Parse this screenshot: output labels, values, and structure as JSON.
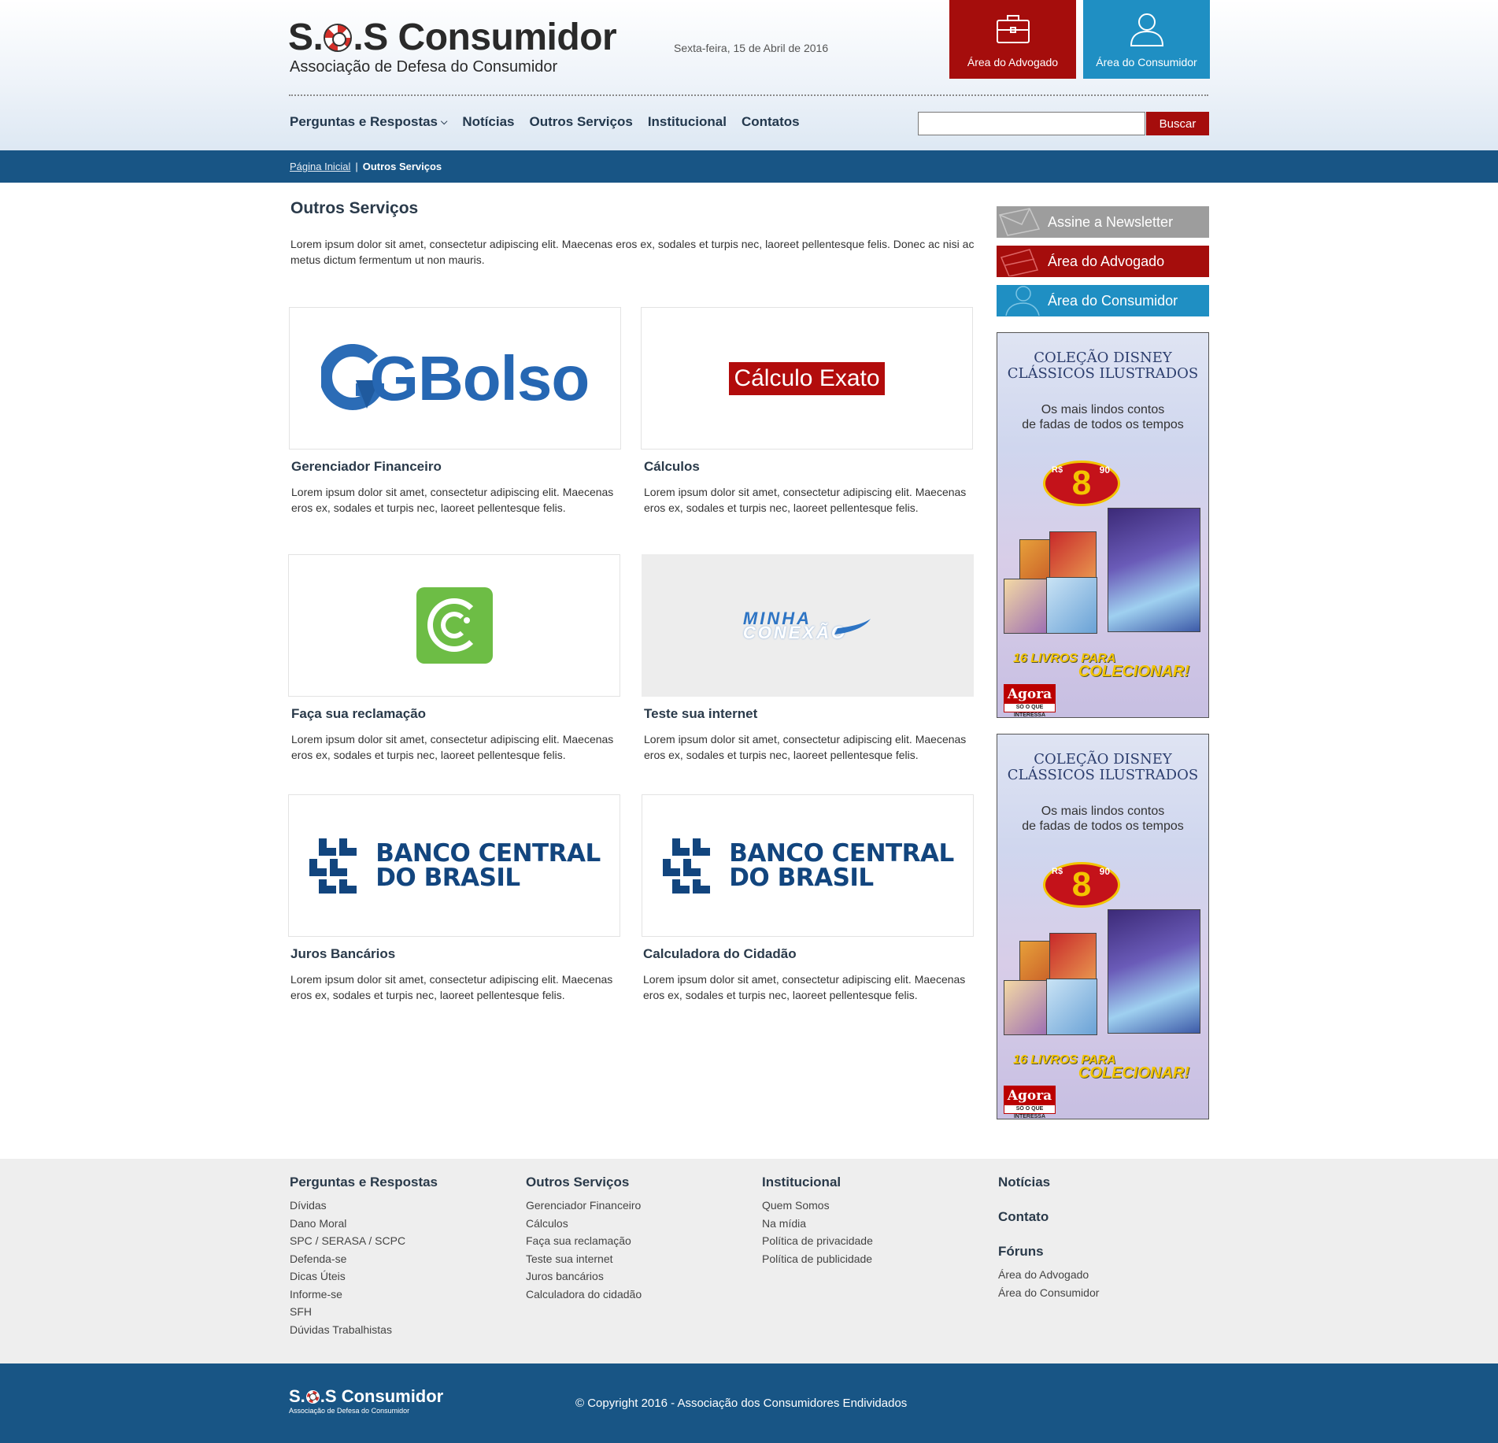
{
  "header": {
    "logo_title_prefix": "S.",
    "logo_title_suffix": ".S Consumidor",
    "logo_subtitle": "Associação de Defesa do Consumidor",
    "date": "Sexta-feira, 15 de Abril de 2016",
    "area_advogado": "Área do Advogado",
    "area_consumidor": "Área do Consumidor"
  },
  "nav": {
    "items": [
      "Perguntas e Respostas",
      "Notícias",
      "Outros Serviços",
      "Institucional",
      "Contatos"
    ],
    "search_value": "",
    "search_button": "Buscar"
  },
  "breadcrumb": {
    "home": "Página Inicial",
    "separator": "|",
    "current": "Outros Serviços"
  },
  "main": {
    "title": "Outros Serviços",
    "intro": "Lorem ipsum dolor sit amet, consectetur adipiscing elit. Maecenas eros ex, sodales et turpis nec, laoreet pellentesque felis. Donec ac nisi ac metus dictum fermentum ut non mauris.",
    "cards": [
      {
        "title": "Gerenciador Financeiro",
        "desc": "Lorem ipsum dolor sit amet, consectetur adipiscing elit. Maecenas eros ex, sodales et turpis nec, laoreet pellentesque felis.",
        "logo": "GBolso"
      },
      {
        "title": "Cálculos",
        "desc": "Lorem ipsum dolor sit amet, consectetur adipiscing elit. Maecenas eros ex, sodales et turpis nec, laoreet pellentesque felis.",
        "logo": "Cálculo Exato"
      },
      {
        "title": "Faça sua reclamação",
        "desc": "Lorem ipsum dolor sit amet, consectetur adipiscing elit. Maecenas eros ex, sodales et turpis nec, laoreet pellentesque felis.",
        "logo": ""
      },
      {
        "title": "Teste sua internet",
        "desc": "Lorem ipsum dolor sit amet, consectetur adipiscing elit. Maecenas eros ex, sodales et turpis nec, laoreet pellentesque felis.",
        "logo_line1": "MINHA",
        "logo_line2": "CONEXÃO"
      },
      {
        "title": "Juros Bancários",
        "desc": "Lorem ipsum dolor sit amet, consectetur adipiscing elit. Maecenas eros ex, sodales et turpis nec, laoreet pellentesque felis.",
        "logo_line1": "BANCO CENTRAL",
        "logo_line2": "DO BRASIL"
      },
      {
        "title": "Calculadora do Cidadão",
        "desc": "Lorem ipsum dolor sit amet, consectetur adipiscing elit. Maecenas eros ex, sodales et turpis nec, laoreet pellentesque felis.",
        "logo_line1": "BANCO CENTRAL",
        "logo_line2": "DO BRASIL"
      }
    ]
  },
  "sidebar": {
    "newsletter": "Assine a Newsletter",
    "advogado": "Área do Advogado",
    "consumidor": "Área do Consumidor",
    "ad": {
      "title_line1": "COLEÇÃO DISNEY",
      "title_line2": "CLÁSSICOS ILUSTRADOS",
      "sub_line1": "Os mais lindos contos",
      "sub_line2": "de fadas de todos os tempos",
      "currency": "R$",
      "price_int": "8",
      "price_cents": "90",
      "collect_line1": "16 LIVROS PARA",
      "collect_line2": "COLECIONAR!",
      "brand": "Agora",
      "brand_tag": "SÓ O QUE INTERESSA"
    }
  },
  "footer": {
    "col1": {
      "title": "Perguntas e Respostas",
      "links": [
        "Dívidas",
        "Dano Moral",
        "SPC / SERASA / SCPC",
        "Defenda-se",
        "Dicas Úteis",
        "Informe-se",
        "SFH",
        "Dúvidas Trabalhistas"
      ]
    },
    "col2": {
      "title": "Outros Serviços",
      "links": [
        "Gerenciador Financeiro",
        "Cálculos",
        "Faça sua reclamação",
        "Teste sua internet",
        "Juros bancários",
        "Calculadora do cidadão"
      ]
    },
    "col3": {
      "title": "Institucional",
      "links": [
        "Quem Somos",
        "Na mídia",
        "Política de privacidade",
        "Política de publicidade"
      ]
    },
    "col4": {
      "noticias": "Notícias",
      "contato": "Contato",
      "foruns": "Fóruns",
      "links": [
        "Área do Advogado",
        "Área do Consumidor"
      ]
    }
  },
  "bottom": {
    "logo_title_prefix": "S.",
    "logo_title_suffix": ".S Consumidor",
    "logo_subtitle": "Associação de Defesa do Consumidor",
    "copyright": "© Copyright 2016 - Associação dos Consumidores Endividados"
  },
  "colors": {
    "brand_red": "#a50d0c",
    "brand_blue": "#185585",
    "accent_cyan": "#1f8fc3",
    "footer_bg": "#eeeeee"
  }
}
